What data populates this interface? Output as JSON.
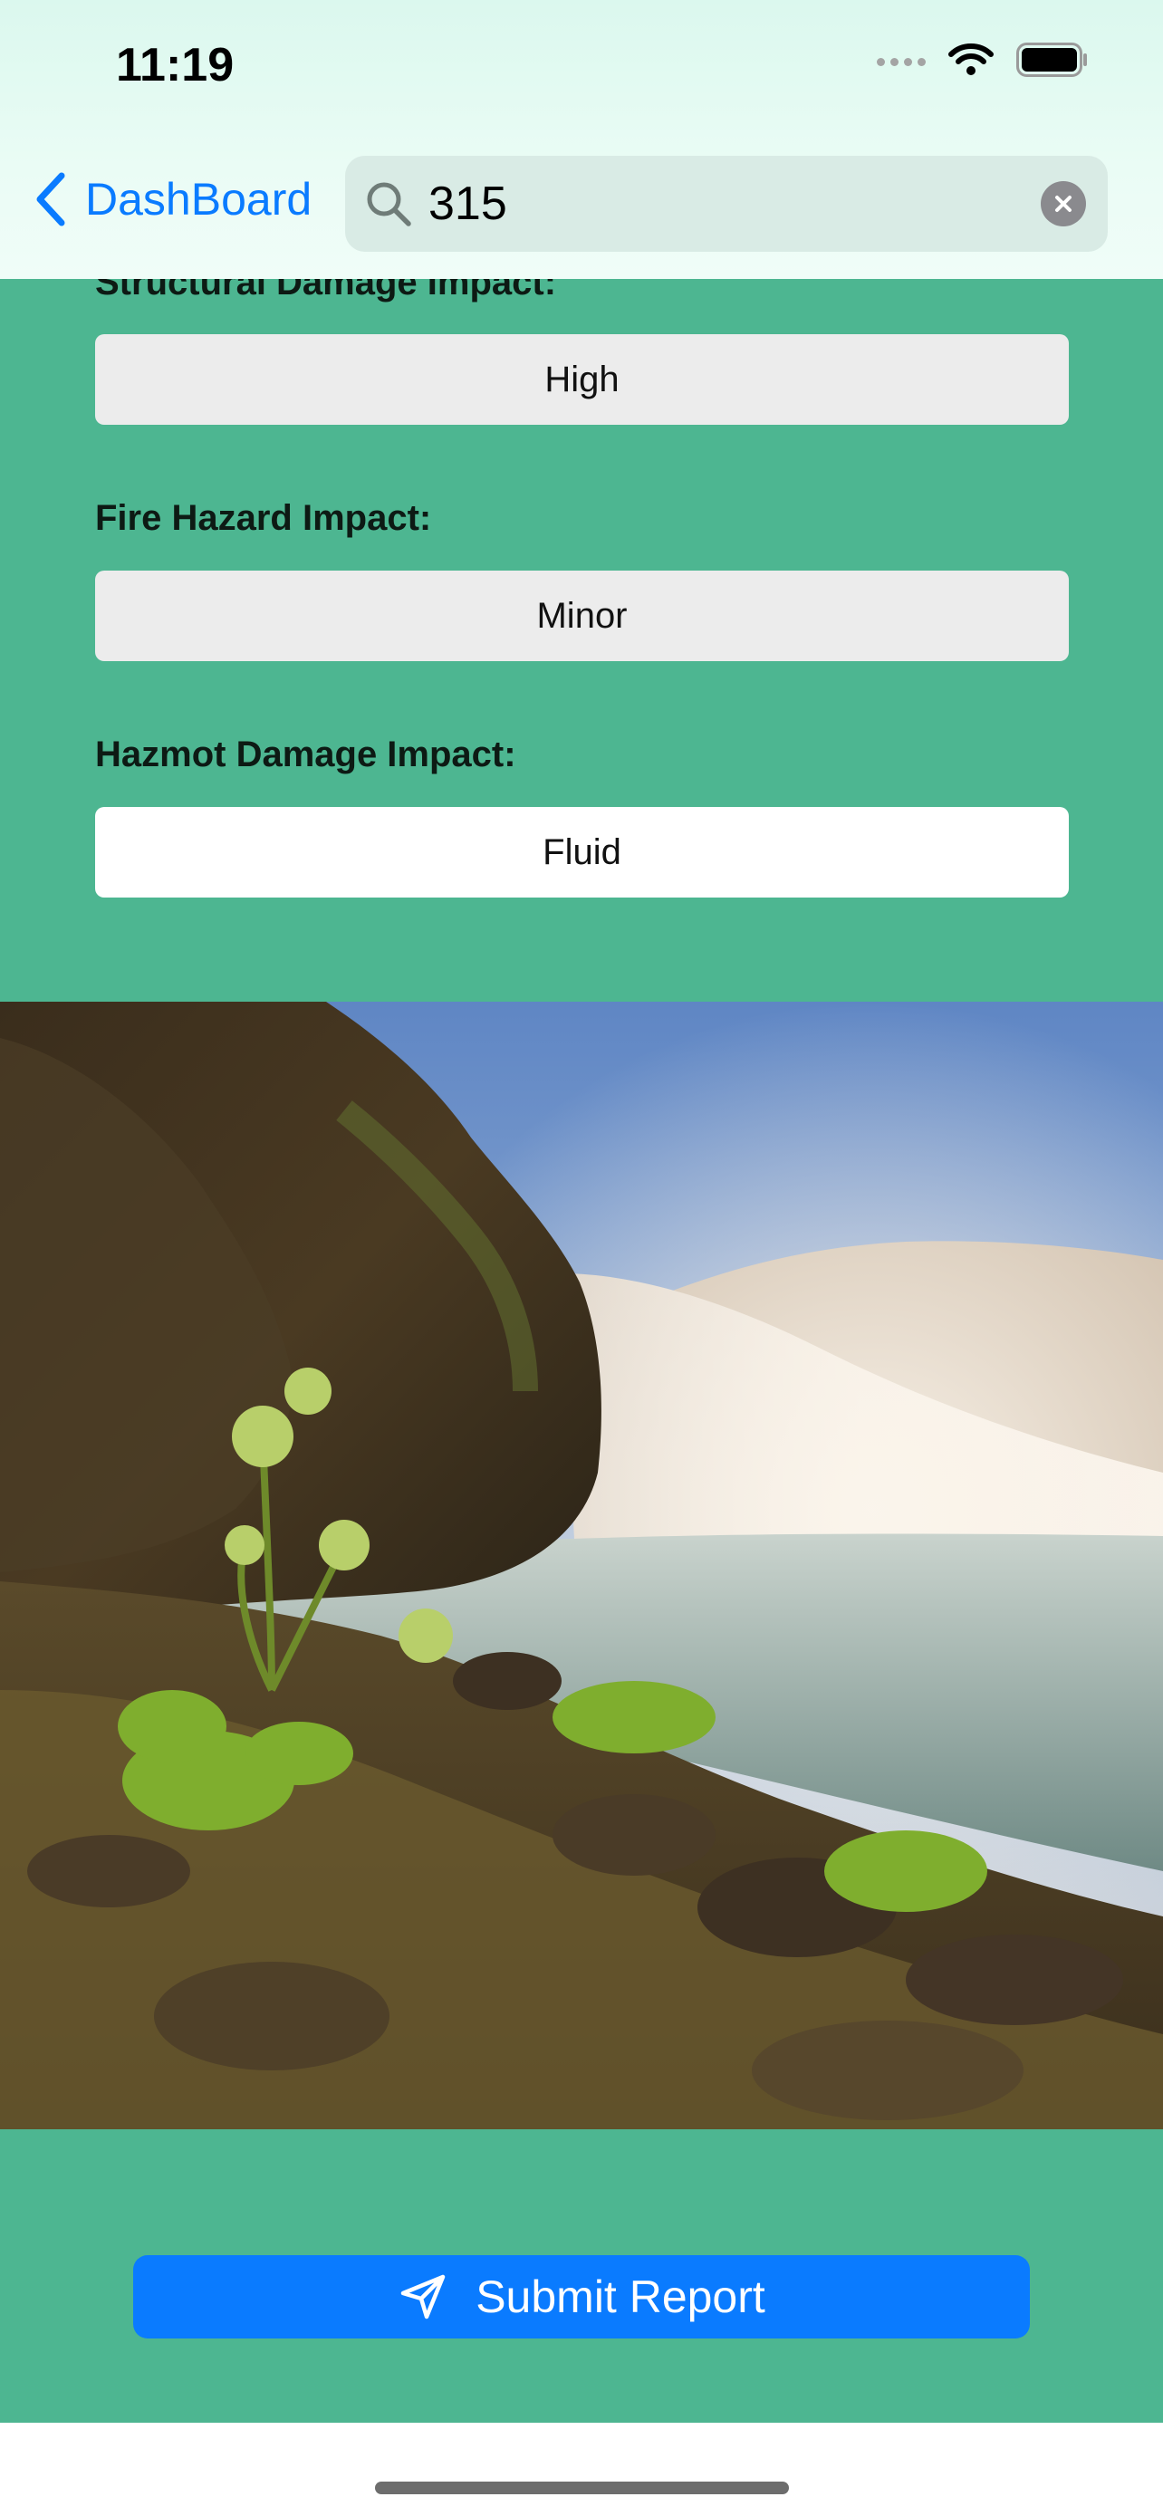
{
  "status_bar": {
    "time": "11:19"
  },
  "nav": {
    "back_label": "DashBoard",
    "search_value": "315"
  },
  "fields": [
    {
      "label": "Structural Damage Impact:",
      "value": "High"
    },
    {
      "label": "Fire Hazard Impact:",
      "value": "Minor"
    },
    {
      "label": "Hazmot Damage Impact:",
      "value": "Fluid"
    }
  ],
  "submit": {
    "label": "Submit Report",
    "icon": "paper-plane-icon"
  },
  "colors": {
    "background": "#4db691",
    "accent": "#0a7bff",
    "header": "#e3faf1"
  }
}
